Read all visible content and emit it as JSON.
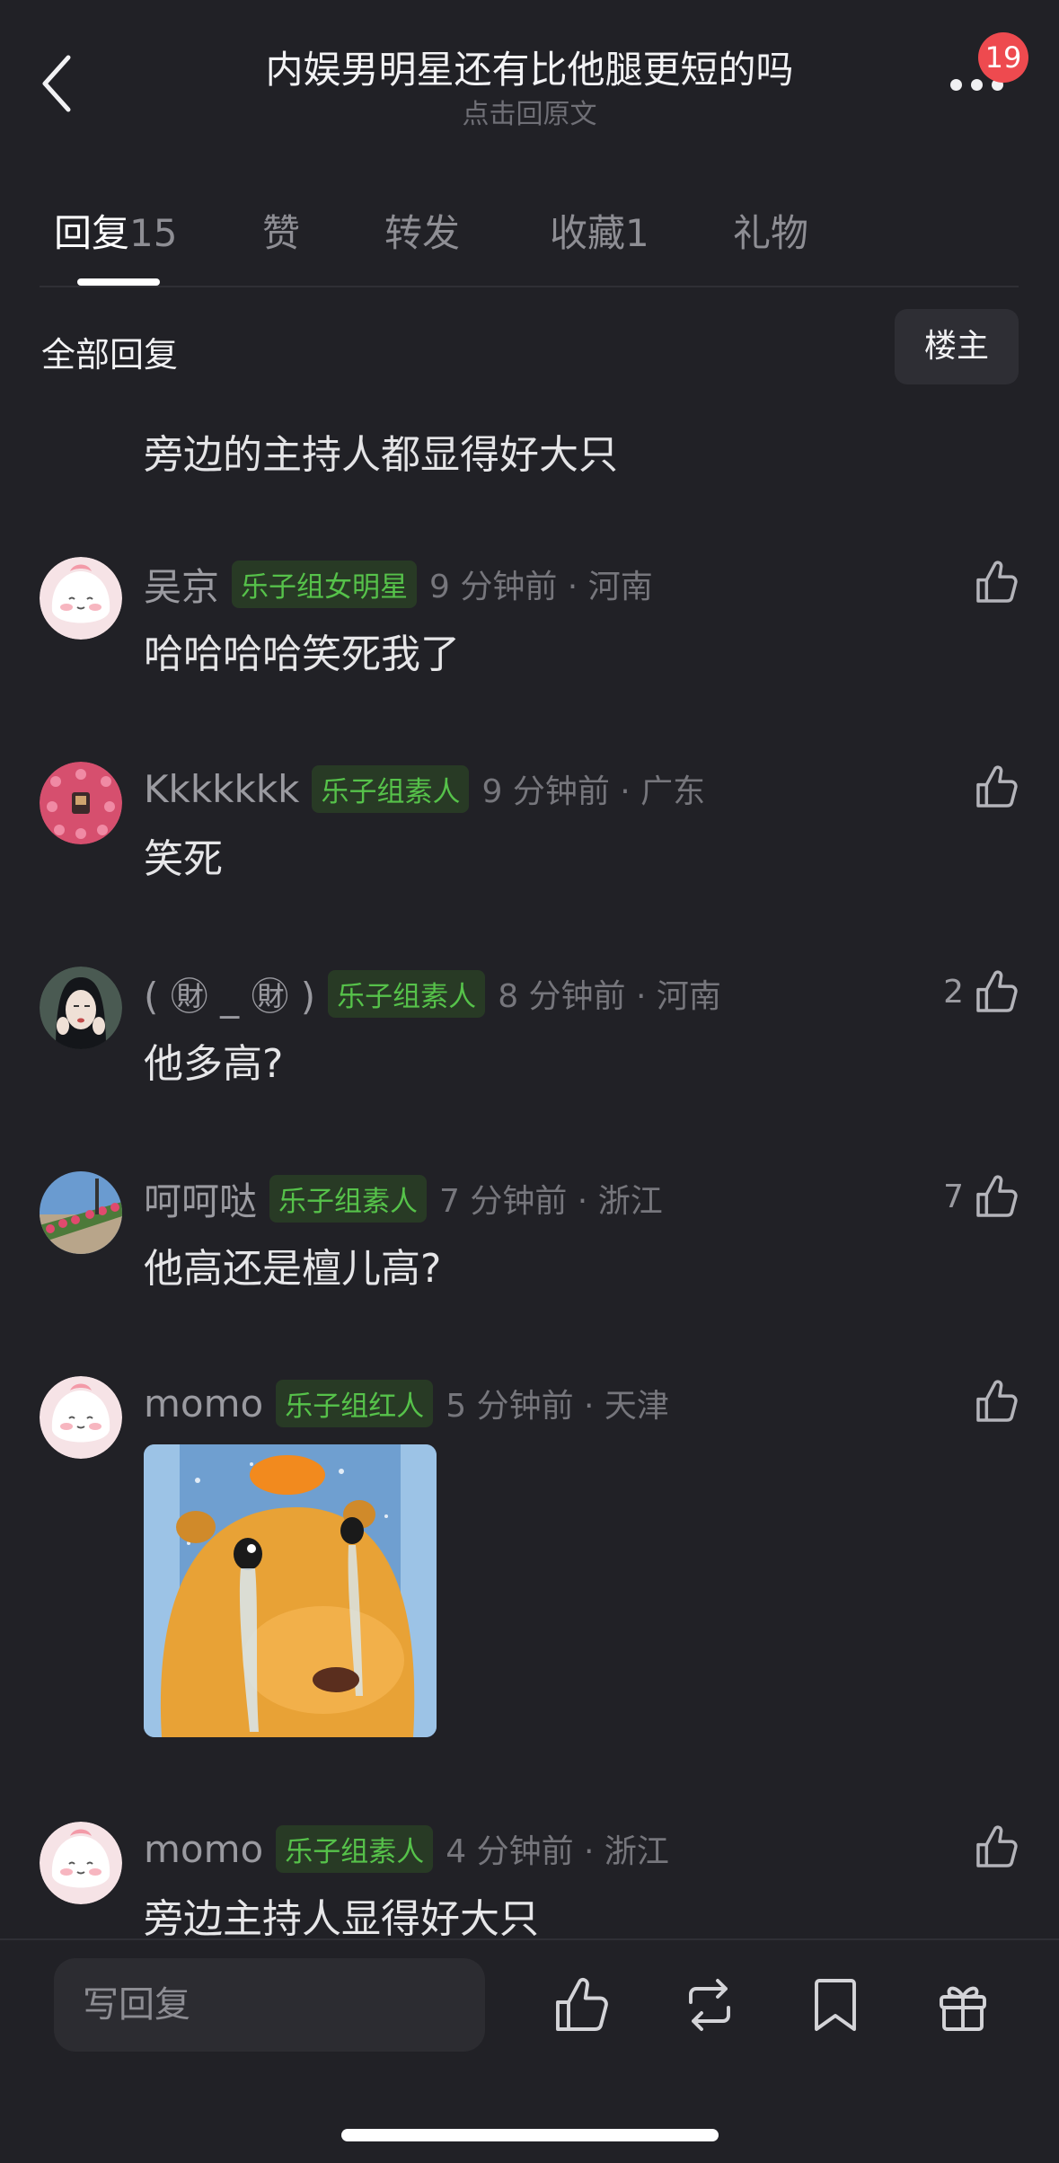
{
  "header": {
    "title": "内娱男明星还有比他腿更短的吗",
    "subtitle": "点击回原文",
    "notification_count": "19"
  },
  "tabs": [
    {
      "label": "回复",
      "count": "15"
    },
    {
      "label": "赞",
      "count": ""
    },
    {
      "label": "转发",
      "count": ""
    },
    {
      "label": "收藏",
      "count": "1"
    },
    {
      "label": "礼物",
      "count": ""
    }
  ],
  "filter": {
    "all_replies_label": "全部回复",
    "op_button_label": "楼主"
  },
  "partial_comment_text": "旁边的主持人都显得好大只",
  "comments": [
    {
      "username": "吴京",
      "tag": "乐子组女明星",
      "time": "9 分钟前 · 河南",
      "likes": "",
      "text": "哈哈哈哈笑死我了",
      "avatar": "pink-blob-avatar"
    },
    {
      "username": "Kkkkkkk",
      "tag": "乐子组素人",
      "time": "9 分钟前 · 广东",
      "likes": "",
      "text": "笑死",
      "avatar": "pink-pattern-avatar"
    },
    {
      "username": "( ㊖ _ ㊖ )",
      "tag": "乐子组素人",
      "time": "8 分钟前 · 河南",
      "likes": "2",
      "text": "他多高?",
      "avatar": "woman-photo-avatar"
    },
    {
      "username": "呵呵哒",
      "tag": "乐子组素人",
      "time": "7 分钟前 · 浙江",
      "likes": "7",
      "text": "他高还是檀儿高?",
      "avatar": "flower-street-avatar"
    },
    {
      "username": "momo",
      "tag": "乐子组红人",
      "time": "5 分钟前 · 天津",
      "likes": "",
      "text": "",
      "avatar": "pink-blob-avatar",
      "image": "crying-capybara-sticker"
    },
    {
      "username": "momo",
      "tag": "乐子组素人",
      "time": "4 分钟前 · 浙江",
      "likes": "",
      "text": "旁边主持人显得好大只",
      "avatar": "pink-blob-avatar"
    }
  ],
  "bottom_bar": {
    "reply_placeholder": "写回复",
    "icons": [
      "like-icon",
      "repost-icon",
      "bookmark-icon",
      "gift-icon"
    ]
  },
  "colors": {
    "background": "#212126",
    "tag_green": "#56c24a",
    "badge_red": "#ee4a4f"
  }
}
